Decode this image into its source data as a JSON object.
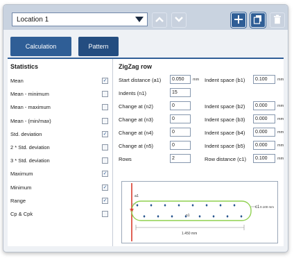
{
  "toolbar": {
    "location_value": "Location 1"
  },
  "tabs": [
    {
      "label": "Calculation"
    },
    {
      "label": "Pattern"
    }
  ],
  "statistics": {
    "title": "Statistics",
    "items": [
      {
        "label": "Mean",
        "checked": true
      },
      {
        "label": "Mean - minimum",
        "checked": false
      },
      {
        "label": "Mean - maximum",
        "checked": false
      },
      {
        "label": "Mean - (min/max)",
        "checked": false
      },
      {
        "label": "Std. deviation",
        "checked": true
      },
      {
        "label": "2 * Std. deviation",
        "checked": false
      },
      {
        "label": "3 * Std. deviation",
        "checked": false
      },
      {
        "label": "Maximum",
        "checked": true
      },
      {
        "label": "Minimum",
        "checked": true
      },
      {
        "label": "Range",
        "checked": true
      },
      {
        "label": "Cp & Cpk",
        "checked": false
      }
    ]
  },
  "zigzag": {
    "title": "ZigZag row",
    "start_distance_label": "Start distance (a1)",
    "start_distance_value": "0.050",
    "start_distance_unit": "mm",
    "indent_b1_label": "Indent space (b1)",
    "indent_b1_value": "0.100",
    "indent_b1_unit": "mm",
    "indents_label": "Indents (n1)",
    "indents_value": "15",
    "change_n2_label": "Change at (n2)",
    "change_n2_value": "0",
    "indent_b2_label": "Indent space (b2)",
    "indent_b2_value": "0.000",
    "indent_b2_unit": "mm",
    "change_n3_label": "Change at (n3)",
    "change_n3_value": "0",
    "indent_b3_label": "Indent space (b3)",
    "indent_b3_value": "0.000",
    "indent_b3_unit": "mm",
    "change_n4_label": "Change at (n4)",
    "change_n4_value": "0",
    "indent_b4_label": "Indent space (b4)",
    "indent_b4_value": "0.000",
    "indent_b4_unit": "mm",
    "change_n5_label": "Change at (n5)",
    "change_n5_value": "0",
    "indent_b5_label": "Indent space (b5)",
    "indent_b5_value": "0.000",
    "indent_b5_unit": "mm",
    "rows_label": "Rows",
    "rows_value": "2",
    "row_distance_label": "Row distance (c1)",
    "row_distance_value": "0.100",
    "row_distance_unit": "mm"
  },
  "diagram": {
    "a1_label": "a1",
    "c1_label": "c1",
    "c1_value": "0.100 mm",
    "n1_label": "n1",
    "length_value": "1.450 mm"
  },
  "colors": {
    "accent": "#2f5e96",
    "red_line": "#d93a2b",
    "green_line": "#8fd14f",
    "marker": "#1f4f8a"
  },
  "icons": [
    "dropdown-caret-icon",
    "chevron-up-icon",
    "chevron-down-icon",
    "plus-icon",
    "copy-icon",
    "trash-icon"
  ]
}
